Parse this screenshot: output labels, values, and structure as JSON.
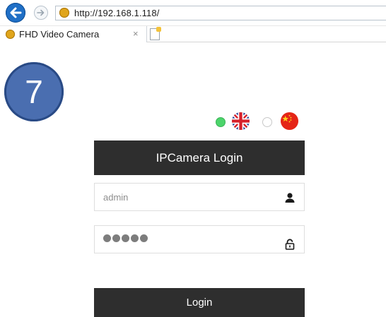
{
  "browser": {
    "url": "http://192.168.1.118/",
    "tab_title": "FHD Video Camera",
    "tab_close": "×",
    "icons": {
      "back": "arrow-left-icon",
      "forward": "arrow-right-icon",
      "favicon": "camera-favicon-icon",
      "new_tab": "new-tab-icon"
    },
    "colors": {
      "back_button": "#1f6fc6"
    }
  },
  "step_badge": {
    "number": "7",
    "color": "#4a6eb0"
  },
  "language": {
    "options": [
      {
        "id": "en",
        "flag": "uk-flag-icon",
        "selected": true
      },
      {
        "id": "zh",
        "flag": "china-flag-icon",
        "selected": false
      }
    ],
    "selected_color": "#4cd46b"
  },
  "login": {
    "title": "IPCamera Login",
    "username_value": "admin",
    "password_masked_length": 5,
    "username_icon": "user-icon",
    "password_icon": "lock-icon",
    "button_label": "Login",
    "accent_color": "#2e2e2e"
  }
}
